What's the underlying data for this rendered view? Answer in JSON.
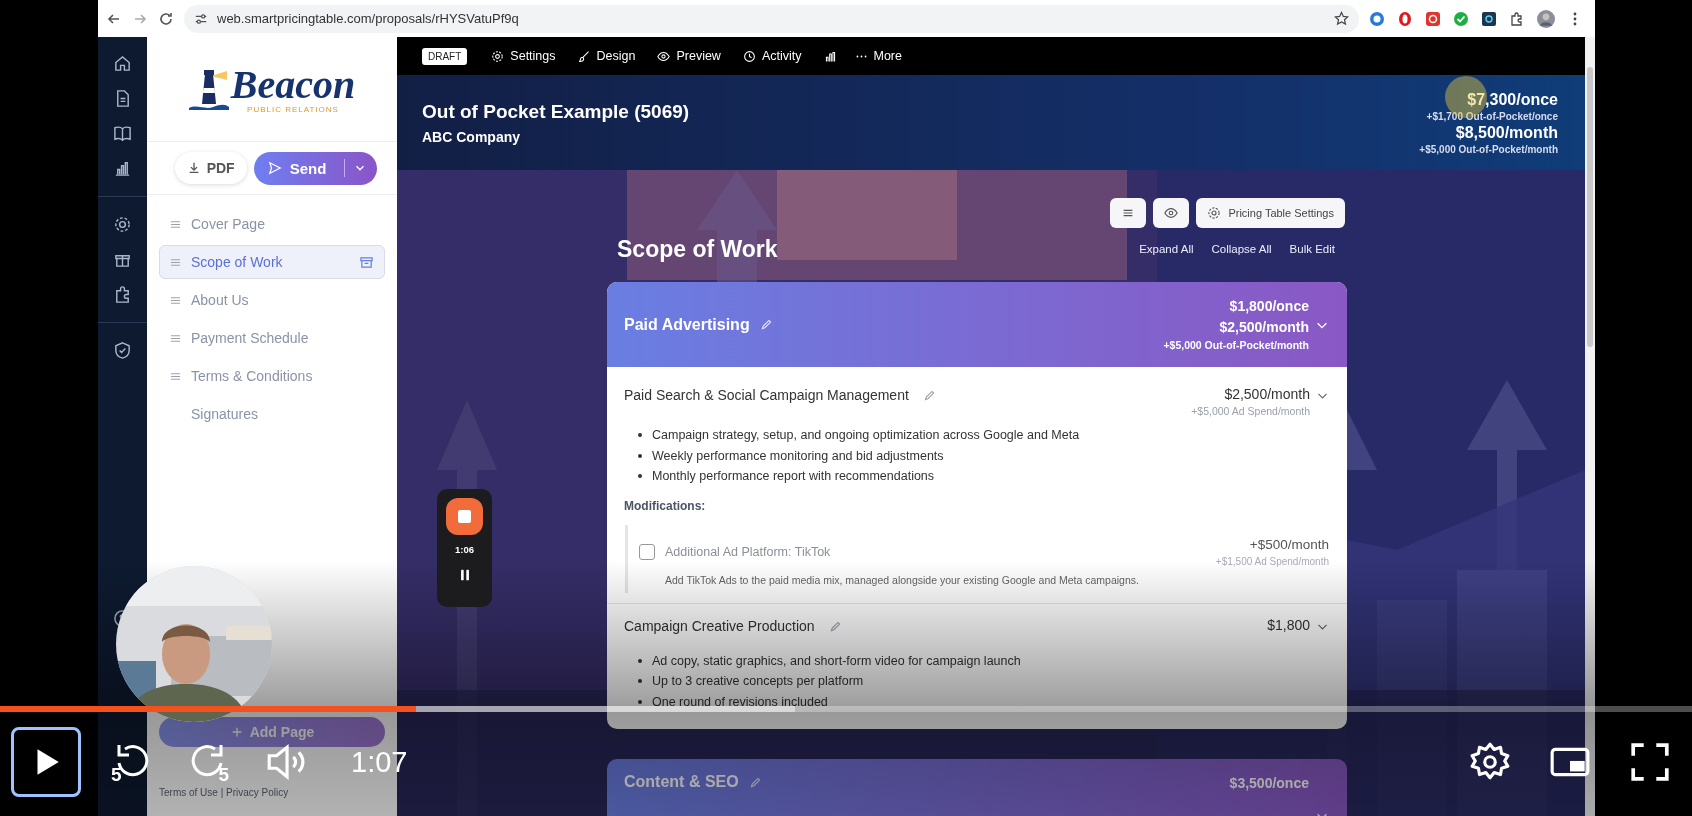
{
  "browser": {
    "url": "web.smartpricingtable.com/proposals/rHYSVatuPf9q"
  },
  "sidebar": {
    "logo": {
      "name": "Beacon",
      "tagline": "PUBLIC RELATIONS"
    },
    "buttons": [
      {
        "label": "PDF"
      },
      {
        "label": "Send"
      }
    ],
    "pages": [
      {
        "label": "Cover Page",
        "selected": false,
        "kind": "page"
      },
      {
        "label": "Scope of Work",
        "selected": true,
        "kind": "page"
      },
      {
        "label": "About Us",
        "selected": false,
        "kind": "page"
      },
      {
        "label": "Payment Schedule",
        "selected": false,
        "kind": "page"
      },
      {
        "label": "Terms & Conditions",
        "selected": false,
        "kind": "page"
      },
      {
        "label": "Signatures",
        "selected": false,
        "kind": "signature"
      }
    ],
    "add_page": "Add Page",
    "footer": "Terms of Use | Privacy Policy"
  },
  "toolbar": {
    "status": "DRAFT",
    "items": [
      "Settings",
      "Design",
      "Preview",
      "Activity"
    ],
    "more": "More"
  },
  "proposal": {
    "title": "Out of Pocket Example (5069)",
    "client": "ABC Company",
    "totals": [
      {
        "amount": "$7,300/once",
        "note": "+$1,700 Out-of-Pocket/once"
      },
      {
        "amount": "$8,500/month",
        "note": "+$5,000 Out-of-Pocket/month"
      }
    ]
  },
  "section": {
    "title": "Scope of Work",
    "settings_button": "Pricing Table Settings",
    "links": [
      "Expand All",
      "Collapse All",
      "Bulk Edit"
    ]
  },
  "groups": [
    {
      "title": "Paid Advertising",
      "prices": [
        "$1,800/once",
        "$2,500/month"
      ],
      "note": "+$5,000 Out-of-Pocket/month",
      "items": [
        {
          "title": "Paid Search & Social Campaign Management",
          "price": "$2,500/month",
          "note": "+$5,000 Ad Spend/month",
          "bullets": [
            "Campaign strategy, setup, and ongoing optimization across Google and Meta",
            "Weekly performance monitoring and bid adjustments",
            "Monthly performance report with recommendations"
          ],
          "modifications_label": "Modifications:",
          "modifications": [
            {
              "title": "Additional Ad Platform: TikTok",
              "checked": false,
              "price": "+$500/month",
              "note": "+$1,500 Ad Spend/month",
              "description": "Add TikTok Ads to the paid media mix, managed alongside your existing Google and Meta campaigns."
            }
          ]
        },
        {
          "title": "Campaign Creative Production",
          "price": "$1,800",
          "bullets": [
            "Ad copy, static graphics, and short-form video for campaign launch",
            "Up to 3 creative concepts per platform",
            "One round of revisions included"
          ]
        }
      ]
    },
    {
      "title": "Content & SEO",
      "prices": [
        "$3,500/once"
      ]
    }
  ],
  "recorder": {
    "time": "1:06"
  },
  "player": {
    "time": "1:07",
    "skip_back": "5",
    "skip_forward": "5",
    "progress": {
      "level": 0.246
    }
  }
}
